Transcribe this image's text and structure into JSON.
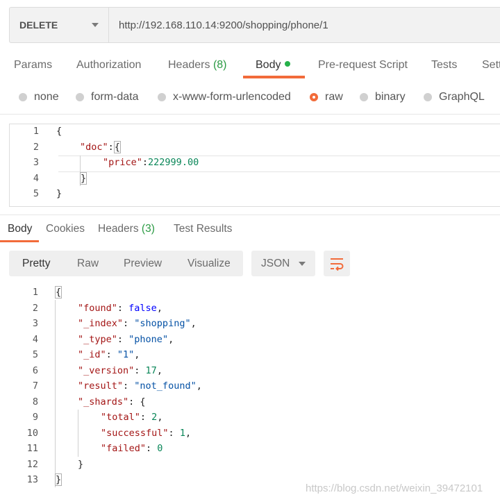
{
  "request": {
    "method": "DELETE",
    "url": "http://192.168.110.14:9200/shopping/phone/1"
  },
  "request_tabs": [
    {
      "label": "Params"
    },
    {
      "label": "Authorization"
    },
    {
      "label": "Headers",
      "count": "(8)"
    },
    {
      "label": "Body",
      "active": true
    },
    {
      "label": "Pre-request Script"
    },
    {
      "label": "Tests"
    },
    {
      "label": "Sett"
    }
  ],
  "body_types": [
    {
      "label": "none",
      "selected": false
    },
    {
      "label": "form-data",
      "selected": false
    },
    {
      "label": "x-www-form-urlencoded",
      "selected": false
    },
    {
      "label": "raw",
      "selected": true
    },
    {
      "label": "binary",
      "selected": false
    },
    {
      "label": "GraphQL",
      "selected": false
    }
  ],
  "request_body": {
    "line_numbers": [
      "1",
      "2",
      "3",
      "4",
      "5"
    ],
    "lines": [
      "{",
      "\"doc\":{",
      "\"price\":222999.00",
      "}",
      "}"
    ]
  },
  "response_tabs": [
    {
      "label": "Body",
      "active": true
    },
    {
      "label": "Cookies"
    },
    {
      "label": "Headers",
      "count": "(3)"
    },
    {
      "label": "Test Results"
    }
  ],
  "view_modes": [
    "Pretty",
    "Raw",
    "Preview",
    "Visualize"
  ],
  "active_view_mode": "Pretty",
  "format": "JSON",
  "response_body": {
    "line_numbers": [
      "1",
      "2",
      "3",
      "4",
      "5",
      "6",
      "7",
      "8",
      "9",
      "10",
      "11",
      "12",
      "13"
    ],
    "lines": [
      "{",
      "\"found\": false,",
      "\"_index\": \"shopping\",",
      "\"_type\": \"phone\",",
      "\"_id\": \"1\",",
      "\"_version\": 17,",
      "\"result\": \"not_found\",",
      "\"_shards\": {",
      "\"total\": 2,",
      "\"successful\": 1,",
      "\"failed\": 0",
      "}",
      "}"
    ]
  },
  "watermark": "https://blog.csdn.net/weixin_39472101",
  "colors": {
    "accent": "#f26b3a",
    "count_green": "#2a9a43",
    "dot_green": "#26b14a"
  }
}
